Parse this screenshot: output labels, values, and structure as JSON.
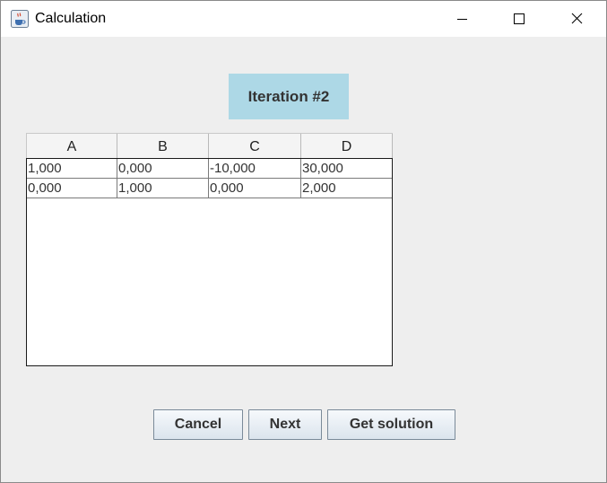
{
  "window": {
    "title": "Calculation",
    "icon": "java-cup-icon",
    "controls": [
      "minimize-icon",
      "maximize-icon",
      "close-icon"
    ]
  },
  "iteration": {
    "label": "Iteration #2",
    "bg_color": "#add8e6"
  },
  "table": {
    "columns": [
      "A",
      "B",
      "C",
      "D"
    ],
    "rows": [
      [
        "1,000",
        "0,000",
        "-10,000",
        "30,000"
      ],
      [
        "0,000",
        "1,000",
        "0,000",
        "2,000"
      ]
    ]
  },
  "buttons": {
    "cancel": "Cancel",
    "next": "Next",
    "get_solution": "Get solution"
  }
}
